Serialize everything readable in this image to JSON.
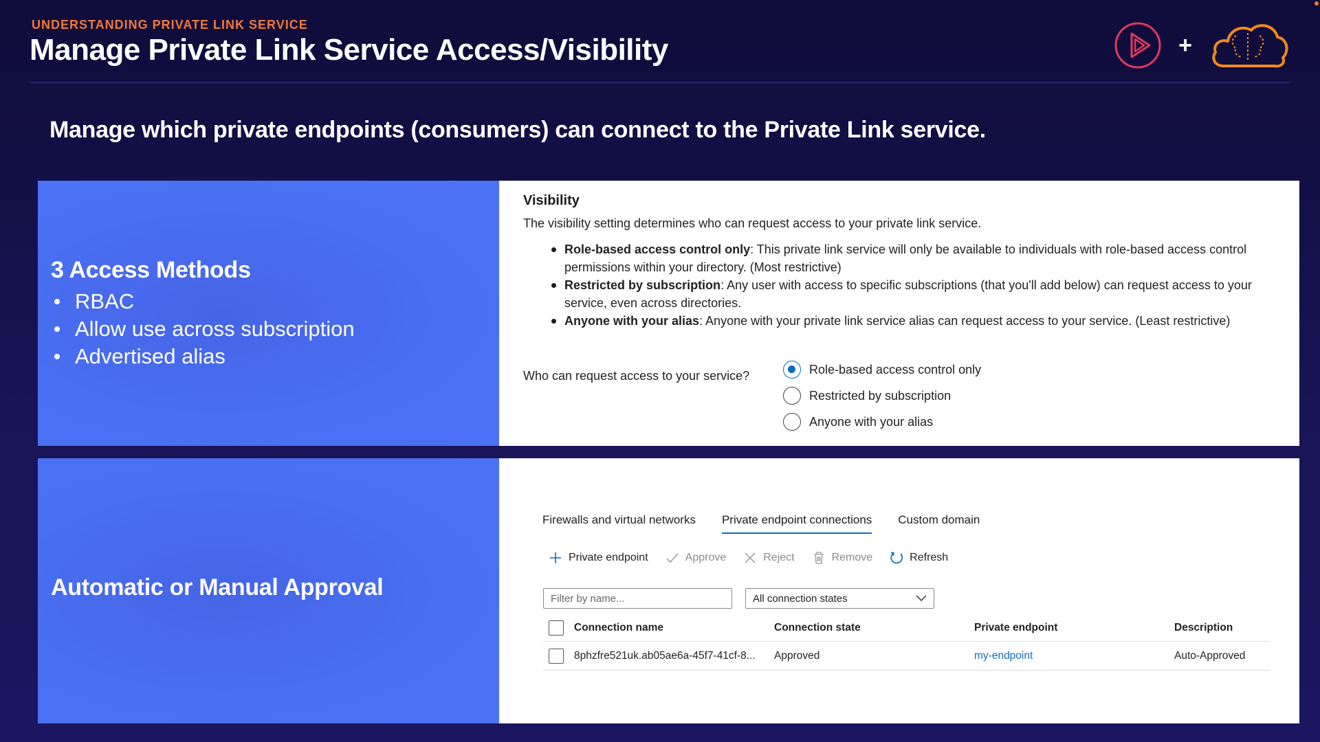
{
  "header": {
    "eyebrow": "UNDERSTANDING PRIVATE LINK SERVICE",
    "title": "Manage Private Link Service Access/Visibility",
    "plus": "+",
    "logo_play_icon": "play-logo-icon",
    "logo_cloud_icon": "cloud-brain-logo-icon"
  },
  "subtitle": "Manage which private endpoints (consumers) can connect to the Private Link service.",
  "access": {
    "heading": "3 Access Methods",
    "items": [
      "RBAC",
      "Allow use across subscription",
      "Advertised alias"
    ]
  },
  "visibility": {
    "heading": "Visibility",
    "description": "The visibility setting determines who can request access to your private link service.",
    "bullets": [
      {
        "term": "Role-based access control only",
        "text": ": This private link service will only be available to individuals with role-based access control permissions within your directory. (Most restrictive)"
      },
      {
        "term": "Restricted by subscription",
        "text": ": Any user with access to specific subscriptions (that you'll add below) can request access to your service, even across directories."
      },
      {
        "term": "Anyone with your alias",
        "text": ": Anyone with your private link service alias can request access to your service. (Least restrictive)"
      }
    ],
    "question": "Who can request access to your service?",
    "options": [
      "Role-based access control only",
      "Restricted by subscription",
      "Anyone with your alias"
    ],
    "selected_index": 0
  },
  "approval": {
    "heading": "Automatic or Manual Approval",
    "tabs": [
      "Firewalls and virtual networks",
      "Private endpoint connections",
      "Custom domain"
    ],
    "active_tab": 1,
    "toolbar": {
      "add": "Private endpoint",
      "approve": "Approve",
      "reject": "Reject",
      "remove": "Remove",
      "refresh": "Refresh"
    },
    "filter_placeholder": "Filter by name...",
    "state_filter": "All connection states",
    "columns": [
      "Connection name",
      "Connection state",
      "Private endpoint",
      "Description"
    ],
    "rows": [
      {
        "name": "8phzfre521uk.ab05ae6a-45f7-41cf-8...",
        "state": "Approved",
        "endpoint": "my-endpoint",
        "description": "Auto-Approved"
      }
    ]
  },
  "colors": {
    "accent_orange": "#f0793a",
    "panel_blue": "#4a6cf0",
    "link_blue": "#0f6cbd",
    "background": "#14104a"
  }
}
